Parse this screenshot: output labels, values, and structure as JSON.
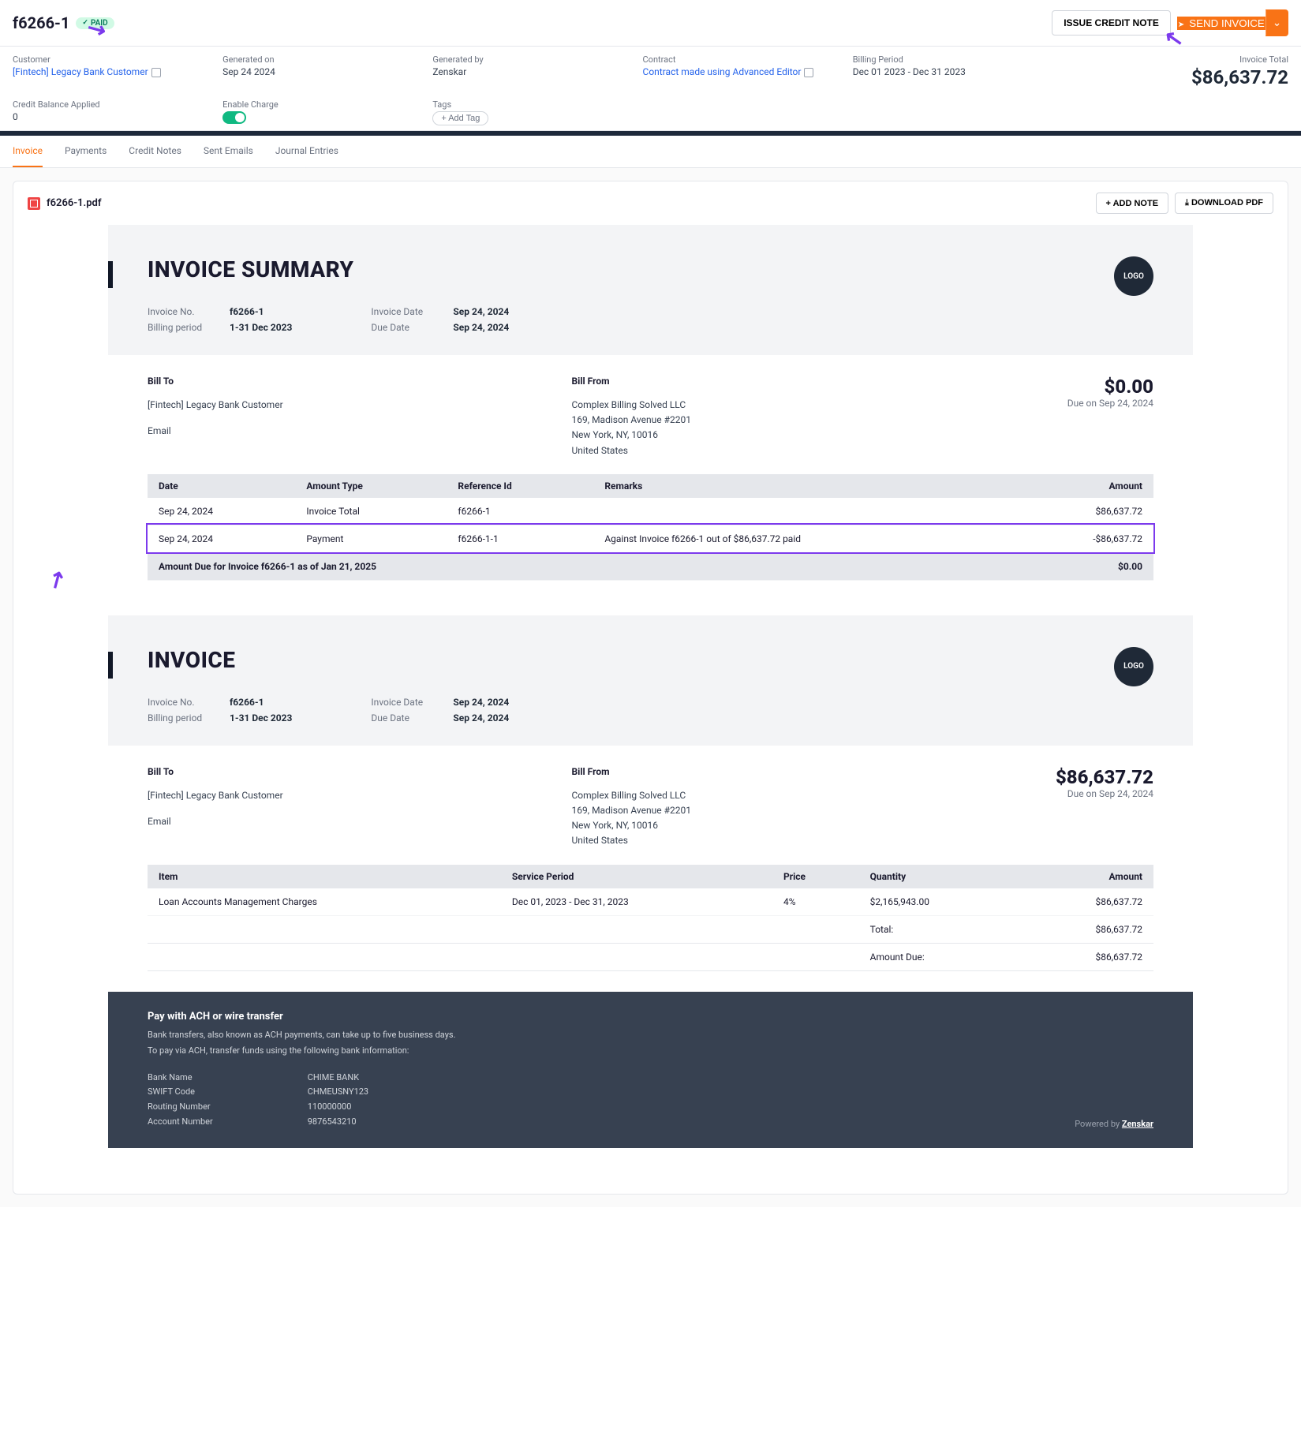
{
  "header": {
    "invoice_id": "f6266-1",
    "status_badge": "PAID",
    "issue_credit_btn": "ISSUE CREDIT NOTE",
    "send_btn": "SEND INVOICE"
  },
  "meta": {
    "customer_label": "Customer",
    "customer_value": "[Fintech] Legacy Bank Customer",
    "generated_on_label": "Generated on",
    "generated_on_value": "Sep 24 2024",
    "generated_by_label": "Generated by",
    "generated_by_value": "Zenskar",
    "contract_label": "Contract",
    "contract_value": "Contract made using Advanced Editor",
    "billing_period_label": "Billing Period",
    "billing_period_value": "Dec 01 2023 - Dec 31 2023",
    "invoice_total_label": "Invoice Total",
    "invoice_total_value": "$86,637.72",
    "credit_balance_label": "Credit Balance Applied",
    "credit_balance_value": "0",
    "enable_charge_label": "Enable Charge",
    "tags_label": "Tags",
    "add_tag": "+  Add Tag"
  },
  "tabs": [
    "Invoice",
    "Payments",
    "Credit Notes",
    "Sent Emails",
    "Journal Entries"
  ],
  "panel": {
    "filename": "f6266-1.pdf",
    "add_note": "+  ADD NOTE",
    "download": "⤓  DOWNLOAD PDF"
  },
  "summary": {
    "title": "INVOICE SUMMARY",
    "logo": "LOGO",
    "invoice_no_label": "Invoice No.",
    "invoice_no": "f6266-1",
    "billing_period_label": "Billing period",
    "billing_period": "1-31 Dec 2023",
    "invoice_date_label": "Invoice Date",
    "invoice_date": "Sep 24, 2024",
    "due_date_label": "Due Date",
    "due_date": "Sep 24, 2024",
    "bill_to_title": "Bill To",
    "bill_to_name": "[Fintech] Legacy Bank Customer",
    "bill_to_email": "Email",
    "bill_from_title": "Bill From",
    "bill_from_lines": [
      "Complex Billing Solved LLC",
      "169, Madison Avenue #2201",
      "New York, NY, 10016",
      "United States"
    ],
    "amount_due": "$0.00",
    "due_on": "Due on Sep 24, 2024",
    "headers": [
      "Date",
      "Amount Type",
      "Reference Id",
      "Remarks",
      "Amount"
    ],
    "rows": [
      {
        "date": "Sep 24, 2024",
        "type": "Invoice Total",
        "ref": "f6266-1",
        "remarks": "",
        "amount": "$86,637.72"
      },
      {
        "date": "Sep 24, 2024",
        "type": "Payment",
        "ref": "f6266-1-1",
        "remarks": "Against Invoice f6266-1 out of $86,637.72 paid",
        "amount": "-$86,637.72",
        "hl": true
      }
    ],
    "footer_text": "Amount Due for Invoice f6266-1 as of Jan 21, 2025",
    "footer_amount": "$0.00"
  },
  "invoice": {
    "title": "INVOICE",
    "amount_due": "$86,637.72",
    "due_on": "Due on Sep 24, 2024",
    "headers": [
      "Item",
      "Service Period",
      "Price",
      "Quantity",
      "Amount"
    ],
    "rows": [
      {
        "item": "Loan Accounts Management Charges",
        "period": "Dec 01, 2023 - Dec 31, 2023",
        "price": "4%",
        "qty": "$2,165,943.00",
        "amount": "$86,637.72"
      }
    ],
    "totals": [
      {
        "label": "Total:",
        "amount": "$86,637.72"
      },
      {
        "label": "Amount Due:",
        "amount": "$86,637.72"
      }
    ]
  },
  "footer": {
    "title": "Pay with ACH or wire transfer",
    "line1": "Bank transfers, also known as ACH payments, can take up to five business days.",
    "line2": "To pay via ACH, transfer funds using the following bank information:",
    "labels": [
      "Bank Name",
      "SWIFT Code",
      "Routing Number",
      "Account Number"
    ],
    "values": [
      "CHIME BANK",
      "CHMEUSNY123",
      "110000000",
      "9876543210"
    ],
    "powered_prefix": "Powered by ",
    "powered_brand": "Zenskar"
  }
}
